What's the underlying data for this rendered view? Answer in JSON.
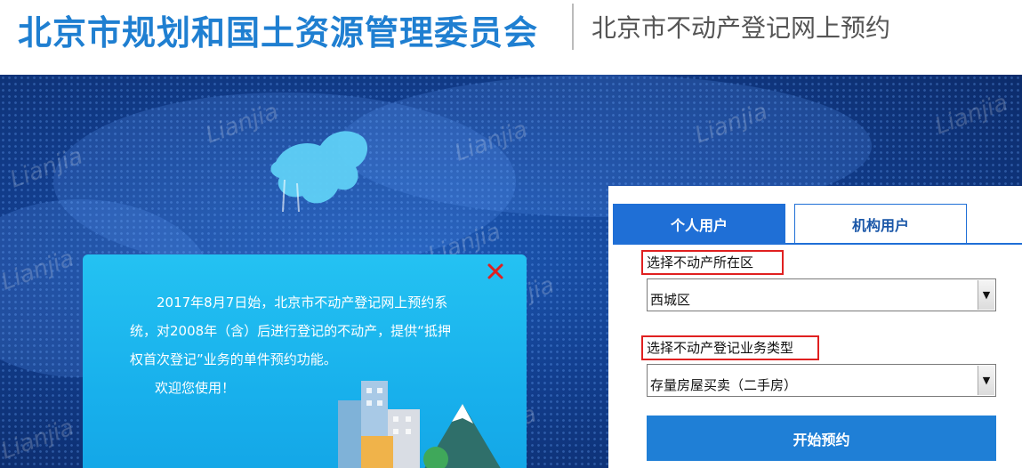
{
  "header": {
    "org_title": "北京市规划和国土资源管理委员会",
    "system_title": "北京市不动产登记网上预约"
  },
  "watermark": "Lianjia",
  "notice": {
    "paragraph": "2017年8月7日始，北京市不动产登记网上预约系统，对2008年（含）后进行登记的不动产，提供“抵押权首次登记”业务的单件预约功能。",
    "welcome": "欢迎您使用！",
    "close_icon": "close-x-icon"
  },
  "tabs": [
    {
      "label": "个人用户",
      "active": true
    },
    {
      "label": "机构用户",
      "active": false
    }
  ],
  "form": {
    "district_label": "选择不动产所在区",
    "district_value": "西城区",
    "business_label": "选择不动产登记业务类型",
    "business_value": "存量房屋买卖（二手房）",
    "start_button": "开始预约"
  },
  "colors": {
    "brand_blue": "#1f7fd1",
    "tab_active": "#1f6fd6",
    "popup_cyan": "#18b0ec",
    "banner_navy": "#123e8e",
    "highlight_red": "#e02020"
  }
}
